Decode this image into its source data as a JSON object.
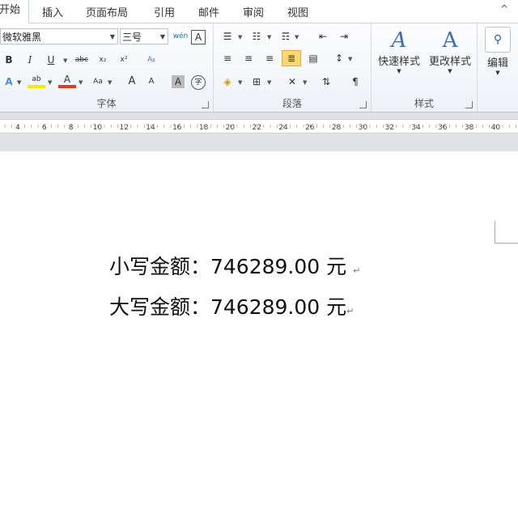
{
  "tabs": [
    {
      "label": "开始",
      "active": true
    },
    {
      "label": "插入"
    },
    {
      "label": "页面布局"
    },
    {
      "label": "引用"
    },
    {
      "label": "邮件"
    },
    {
      "label": "审阅"
    },
    {
      "label": "视图"
    }
  ],
  "collapse_icon": "^",
  "font_group": {
    "label": "字体",
    "font_name": "微软雅黑",
    "font_size": "三号",
    "phonetic_icon": "wén",
    "char_border_icon": "A",
    "bold": "B",
    "italic": "I",
    "underline": "U",
    "strike": "abc",
    "subscript": "x₂",
    "superscript": "x²",
    "clear_format": "Aᵦ",
    "text_effect": "A",
    "highlight": "ab",
    "font_color": "A",
    "change_case": "Aa",
    "grow": "A",
    "shrink": "A",
    "char_shading": "A",
    "enclose": "字"
  },
  "paragraph_group": {
    "label": "段落"
  },
  "styles_group": {
    "label": "样式",
    "quick_styles": "快速样式",
    "change_styles": "更改样式"
  },
  "editing_group": {
    "label": "编辑"
  },
  "ruler": {
    "ticks": [
      "4",
      "6",
      "8",
      "10",
      "12",
      "14",
      "16",
      "18",
      "20",
      "22",
      "24",
      "26",
      "28",
      "30",
      "32",
      "34",
      "36",
      "38",
      "40"
    ]
  },
  "document": {
    "line1": "小写金额：746289.00 元",
    "line2": "大写金额：746289.00 元",
    "para_mark": "↵"
  },
  "colors": {
    "highlight": "#ffe600",
    "font_color": "#e03c1c",
    "active_button": "#fbd873"
  }
}
